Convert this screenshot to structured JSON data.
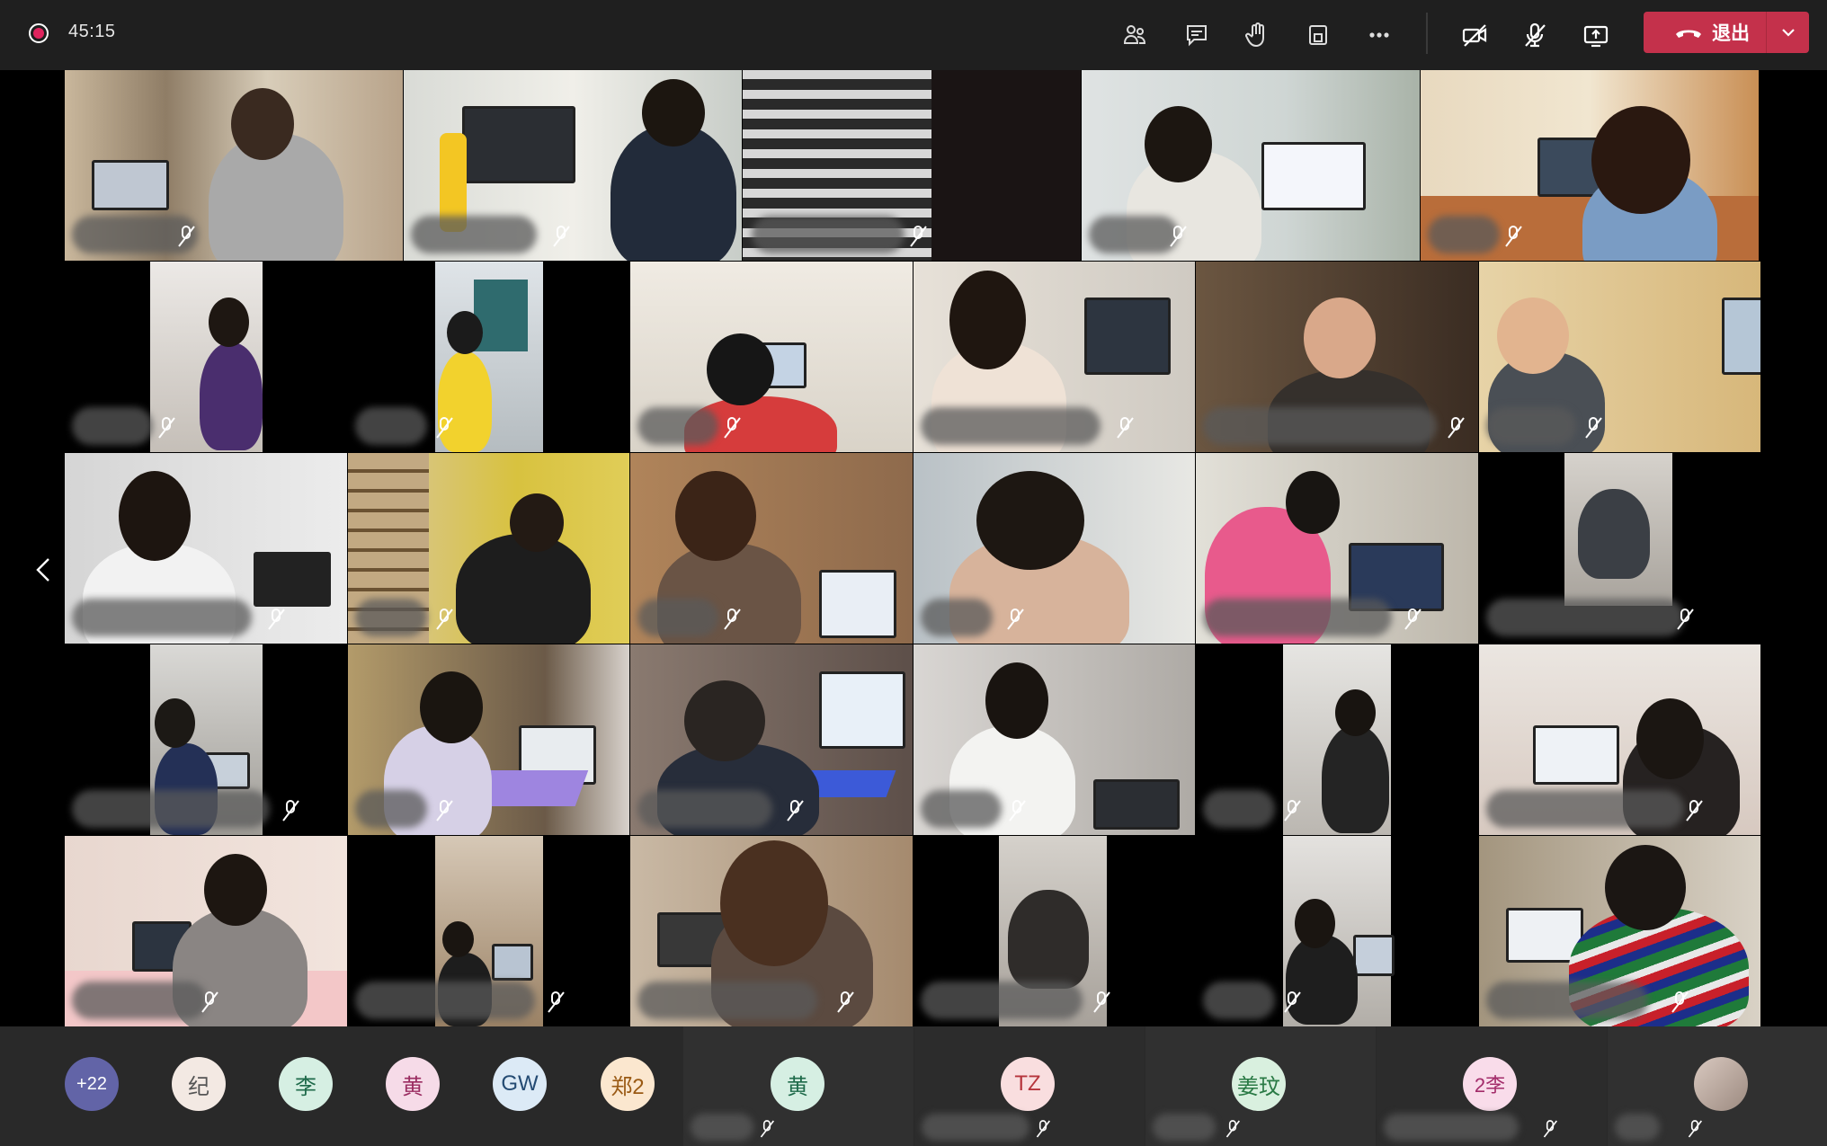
{
  "meeting": {
    "timer": "45:15",
    "leave_label": "退出"
  },
  "toolbar": {
    "icons": [
      "people-icon",
      "chat-icon",
      "raise-hand-icon",
      "rooms-icon",
      "more-icon",
      "camera-off-icon",
      "mic-off-icon",
      "share-screen-icon"
    ]
  },
  "roster": {
    "overflow": "+22",
    "attendees": [
      "纪",
      "李",
      "黄",
      "GW",
      "郑2",
      "黄",
      "TZ",
      "姜玟",
      "2李"
    ]
  },
  "colors": {
    "leave_button": "#c4314b",
    "topbar": "#1f1f1f",
    "roster_bg": "#292929",
    "overflow_avatar": "#6264a7"
  }
}
